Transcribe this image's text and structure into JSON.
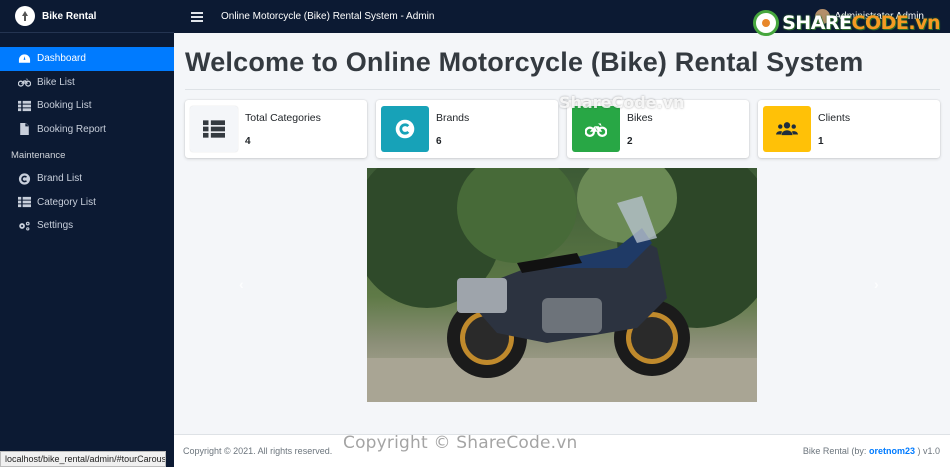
{
  "app": {
    "brand": "Bike Rental",
    "header_title": "Online Motorcycle (Bike) Rental System - Admin",
    "user_name": "Administrator Admin",
    "watermark_logo_prefix": "SHARE",
    "watermark_logo_suffix": "CODE.vn"
  },
  "sidebar": {
    "items": [
      {
        "label": "Dashboard",
        "icon": "dashboard-icon",
        "active": true
      },
      {
        "label": "Bike List",
        "icon": "motorcycle-icon"
      },
      {
        "label": "Booking List",
        "icon": "list-icon"
      },
      {
        "label": "Booking Report",
        "icon": "file-icon"
      }
    ],
    "section_header": "Maintenance",
    "maintenance_items": [
      {
        "label": "Brand List",
        "icon": "copyright-icon"
      },
      {
        "label": "Category List",
        "icon": "th-list-icon"
      },
      {
        "label": "Settings",
        "icon": "cogs-icon"
      }
    ]
  },
  "main": {
    "page_title": "Welcome to Online Motorcycle (Bike) Rental System",
    "watermark_center": "ShareCode.vn",
    "cards": [
      {
        "label": "Total Categories",
        "value": "4",
        "icon": "th-list-icon",
        "color": "#f4f6f9"
      },
      {
        "label": "Brands",
        "value": "6",
        "icon": "copyright-icon",
        "color": "#17a2b8"
      },
      {
        "label": "Bikes",
        "value": "2",
        "icon": "motorcycle-icon",
        "color": "#28a745"
      },
      {
        "label": "Clients",
        "value": "1",
        "icon": "users-icon",
        "color": "#ffc107"
      }
    ],
    "carousel": {
      "prev": "‹",
      "next": "›"
    }
  },
  "footer": {
    "copyright": "Copyright © 2021. All rights reserved.",
    "credit_prefix": "Bike Rental (by:",
    "credit_author": "oretnom23",
    "credit_suffix": ") v1.0",
    "watermark": "Copyright © ShareCode.vn"
  },
  "status_bar": {
    "url": "localhost/bike_rental/admin/#tourCarousel"
  },
  "colors": {
    "sidebar_bg": "#0c1a33",
    "active": "#007bff",
    "accent_link": "#007bff"
  }
}
